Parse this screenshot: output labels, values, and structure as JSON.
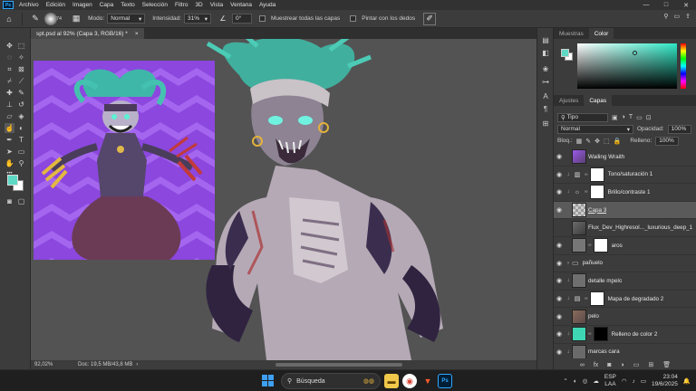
{
  "menubar": {
    "app_logo": "Ps",
    "items": [
      "Archivo",
      "Edición",
      "Imagen",
      "Capa",
      "Texto",
      "Selección",
      "Filtro",
      "3D",
      "Vista",
      "Ventana",
      "Ayuda"
    ],
    "window_controls": [
      "—",
      "□",
      "✕"
    ]
  },
  "options": {
    "brush_size": "74",
    "mode_label": "Modo:",
    "mode_value": "Normal",
    "intensity_label": "Intensidad:",
    "intensity_value": "31%",
    "angle_value": "0°",
    "sample_all_label": "Muestrear todas las capas",
    "finger_paint_label": "Pintar con los dedos"
  },
  "document": {
    "tab_title": "spt.psd al 92% (Capa 3, RGB/16) *",
    "close": "×"
  },
  "status": {
    "zoom": "92,02%",
    "doc_info": "Doc: 19,5 MB/43,8 MB"
  },
  "panels": {
    "top_tabs": [
      "Muestras",
      "Color"
    ],
    "top_active": "Color",
    "mid_tabs": [
      "Ajustes",
      "Capas"
    ],
    "mid_active": "Capas",
    "filter_value": "Tipo",
    "blend_mode": "Normal",
    "opacity_label": "Opacidad:",
    "opacity_value": "100%",
    "lock_label": "Bloq.:",
    "fill_label": "Relleno:",
    "fill_value": "100%"
  },
  "layers": [
    {
      "name": "Wailing Wraith",
      "kind": "image",
      "visible": true,
      "selected": false
    },
    {
      "name": "Tono/saturación 1",
      "kind": "adjust",
      "icon": "hue-sat-icon",
      "visible": true,
      "selected": false
    },
    {
      "name": "Brillo/contraste 1",
      "kind": "adjust",
      "icon": "brightness-icon",
      "visible": true,
      "selected": false
    },
    {
      "name": "Capa 3",
      "kind": "pixel",
      "visible": true,
      "selected": true
    },
    {
      "name": "Flux_Dev_Highresol..._luxurious_deep_1",
      "kind": "image",
      "visible": false,
      "selected": false
    },
    {
      "name": "aros",
      "kind": "masked",
      "visible": true,
      "selected": false
    },
    {
      "name": "pañuelo",
      "kind": "group",
      "visible": true,
      "selected": false
    },
    {
      "name": "detalle mpelo",
      "kind": "pixel",
      "visible": true,
      "selected": false
    },
    {
      "name": "Mapa de degradado 2",
      "kind": "adjust",
      "icon": "gradient-map-icon",
      "visible": true,
      "selected": false
    },
    {
      "name": "pelo",
      "kind": "pixel",
      "visible": true,
      "selected": false
    },
    {
      "name": "Relleno de color 2",
      "kind": "fill",
      "visible": true,
      "selected": false
    },
    {
      "name": "marcas cara",
      "kind": "pixel",
      "visible": true,
      "selected": false
    }
  ],
  "taskbar": {
    "search_placeholder": "Búsqueda",
    "lang_top": "ESP",
    "lang_bottom": "LAA",
    "time": "23:04",
    "date": "19/6/2025"
  },
  "colors": {
    "foreground": "#5ed9c5",
    "background": "#ffffff",
    "accent": "#31a8ff"
  }
}
